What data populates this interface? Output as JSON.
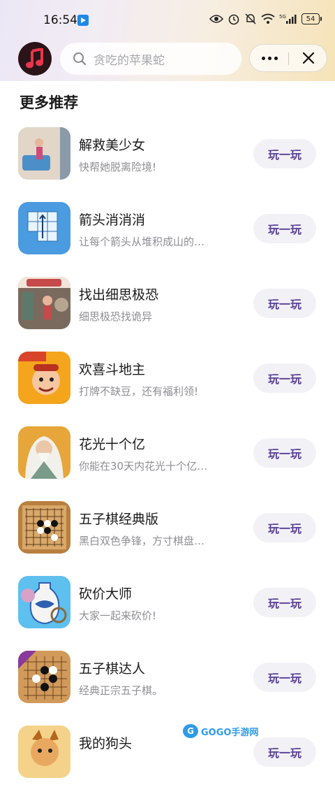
{
  "status_bar": {
    "time": "16:54",
    "battery": "54",
    "network": "5G",
    "icons": [
      "eye-icon",
      "alarm-icon",
      "mute-icon",
      "wifi-icon",
      "signal-icon",
      "battery-icon"
    ]
  },
  "header": {
    "app_icon": "music-note-icon",
    "search_placeholder": "贪吃的苹果蛇",
    "more_icon": "more-dots-icon",
    "close_icon": "close-icon"
  },
  "section_title": "更多推荐",
  "play_label": "玩一玩",
  "items": [
    {
      "name": "解救美少女",
      "desc": "快帮她脱离险境!",
      "thumb_bg": "#c7b8a8",
      "thumb_fg": "#4b8fc9"
    },
    {
      "name": "箭头消消消",
      "desc": "让每个箭头从堆积成山的…",
      "thumb_bg": "#4a9be0",
      "thumb_fg": "#e8f4ff"
    },
    {
      "name": "找出细思极恐",
      "desc": "细思极恐找诡异",
      "thumb_bg": "#7a6a5e",
      "thumb_fg": "#c64a4a"
    },
    {
      "name": "欢喜斗地主",
      "desc": "打牌不缺豆，还有福利领!",
      "thumb_bg": "#f4a51c",
      "thumb_fg": "#d8452a"
    },
    {
      "name": "花光十个亿",
      "desc": "你能在30天内花光十个亿…",
      "thumb_bg": "#e7a63a",
      "thumb_fg": "#f2f0ea"
    },
    {
      "name": "五子棋经典版",
      "desc": "黑白双色争锋，方寸棋盘…",
      "thumb_bg": "#b87f3f",
      "thumb_fg": "#111111"
    },
    {
      "name": "砍价大师",
      "desc": "大家一起来砍价!",
      "thumb_bg": "#5ec0ef",
      "thumb_fg": "#2f5fb0"
    },
    {
      "name": "五子棋达人",
      "desc": "经典正宗五子棋。",
      "thumb_bg": "#d19a5a",
      "thumb_fg": "#111111"
    },
    {
      "name": "我的狗头",
      "desc": "",
      "thumb_bg": "#f4d28a",
      "thumb_fg": "#b5651d"
    }
  ],
  "watermark": {
    "badge": "G",
    "text": "GOGO手游网"
  }
}
